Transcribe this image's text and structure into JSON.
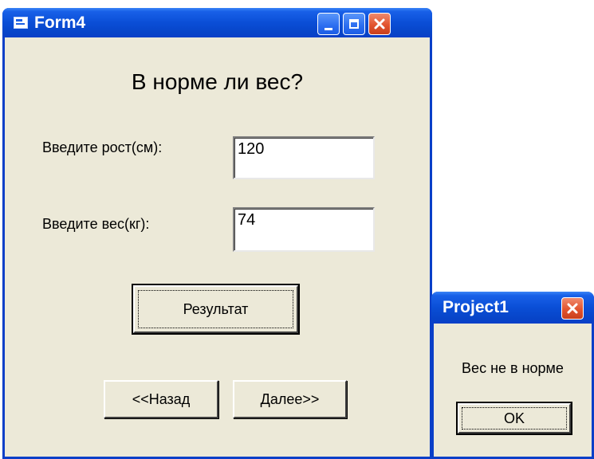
{
  "form4": {
    "title": "Form4",
    "heading": "В норме ли вес?",
    "height_label": "Введите рост(см):",
    "height_value": "120",
    "weight_label": "Введите вес(кг):",
    "weight_value": "74",
    "result_button": "Результат",
    "back_button": "<<Назад",
    "next_button": "Далее>>",
    "buttons": {
      "minimize": "minimize-icon",
      "maximize": "maximize-icon",
      "close": "close-icon"
    }
  },
  "dialog": {
    "title": "Project1",
    "message": "Вес не в норме",
    "ok_button": "OK"
  },
  "colors": {
    "title_bar": "#0a4ed6",
    "window_face": "#ece9d8",
    "close_button": "#e2542f"
  }
}
